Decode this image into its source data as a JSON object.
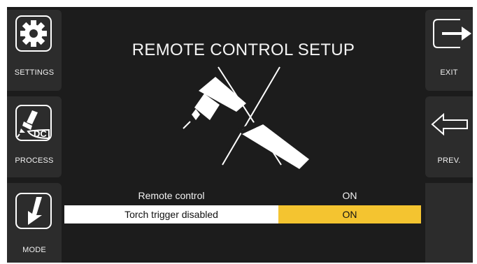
{
  "screen": {
    "title": "REMOTE CONTROL SETUP"
  },
  "left_panel": {
    "buttons": [
      {
        "label": "SETTINGS",
        "icon": "gear-icon"
      },
      {
        "label": "PROCESS",
        "icon": "tig-torch-icon",
        "icon_text": "DC"
      },
      {
        "label": "MODE",
        "icon": "down-arrow-icon"
      }
    ]
  },
  "right_panel": {
    "buttons": [
      {
        "label": "EXIT",
        "icon": "exit-arrow-icon"
      },
      {
        "label": "PREV.",
        "icon": "left-arrow-icon"
      }
    ]
  },
  "settings": [
    {
      "name": "Remote control",
      "value": "ON",
      "selected": false
    },
    {
      "name": "Torch trigger disabled",
      "value": "ON",
      "selected": true
    }
  ],
  "colors": {
    "background": "#1c1c1c",
    "side_button": "#2c2c2c",
    "highlight_value": "#f4c430",
    "highlight_row": "#ffffff"
  }
}
